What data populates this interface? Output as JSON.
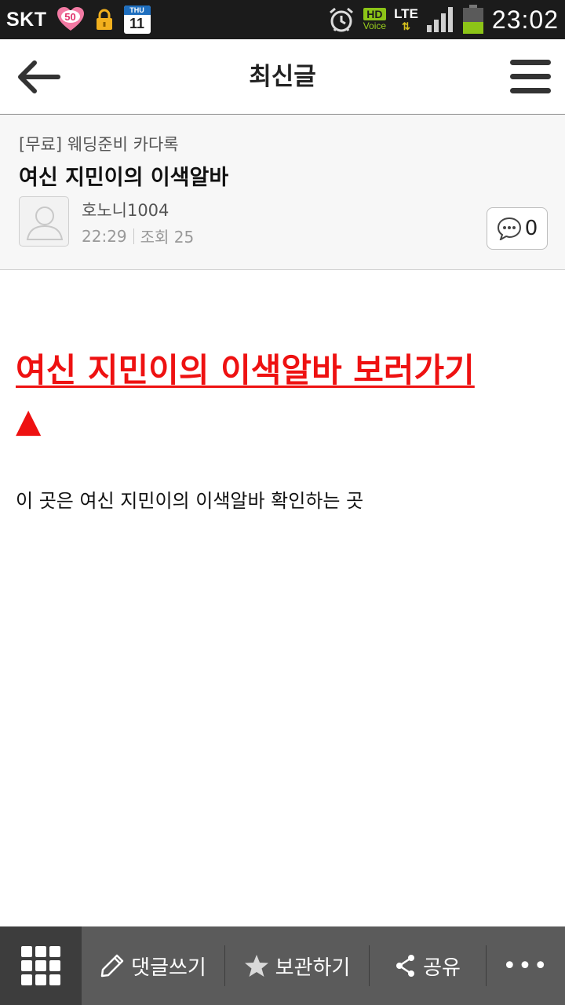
{
  "status_bar": {
    "carrier": "SKT",
    "badge_number": "50",
    "calendar_day_label": "THU",
    "calendar_day": "11",
    "hd_label": "HD",
    "voice_label": "Voice",
    "network": "LTE",
    "network_arrows": "⇅",
    "time": "23:02",
    "battery_level": 0.45
  },
  "appbar": {
    "title": "최신글"
  },
  "post": {
    "category": "[무료] 웨딩준비 카다록",
    "title": "여신 지민이의 이색알바",
    "author": "호노니1004",
    "time": "22:29",
    "views_label": "조회 25",
    "comment_count": "0"
  },
  "content": {
    "link_text": "여신 지민이의 이색알바 보러가기",
    "link_arrow": "▲",
    "body": "이 곳은 여신 지민이의 이색알바 확인하는 곳"
  },
  "toolbar": {
    "comment_label": "댓글쓰기",
    "save_label": "보관하기",
    "share_label": "공유",
    "more_label": "•••"
  },
  "colors": {
    "status_bg": "#1b1b1b",
    "link_red": "#ee1111",
    "toolbar_bg": "#5b5b5b",
    "toolbar_grid_bg": "#3d3d3d",
    "hd_green": "#8cc417",
    "battery_green": "#8cc417"
  }
}
